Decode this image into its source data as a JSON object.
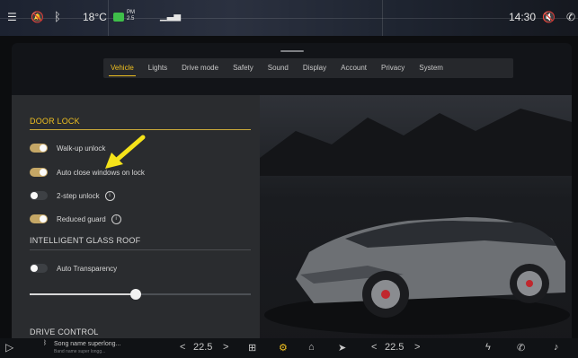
{
  "status_bar": {
    "temperature": "18°C",
    "pm_label": "PM",
    "pm_value": "2.5",
    "time": "14:30",
    "icons": [
      "menu-lines-icon",
      "notifications-muted-icon",
      "bluetooth-icon",
      "air-quality-leaf-icon",
      "signal-icon",
      "mute-icon",
      "phone-icon"
    ]
  },
  "tabs": [
    "Vehicle",
    "Lights",
    "Drive mode",
    "Safety",
    "Sound",
    "Display",
    "Account",
    "Privacy",
    "System"
  ],
  "active_tab": "Vehicle",
  "door_lock": {
    "title": "DOOR LOCK",
    "items": [
      {
        "label": "Walk-up unlock",
        "on": true,
        "info": false
      },
      {
        "label": "Auto close windows on lock",
        "on": true,
        "info": false
      },
      {
        "label": "2-step unlock",
        "on": false,
        "info": true
      },
      {
        "label": "Reduced guard",
        "on": true,
        "info": true
      }
    ]
  },
  "glass_roof": {
    "title": "INTELLIGENT GLASS ROOF",
    "transparency_label": "Auto Transparency",
    "transparency_on": false,
    "slider_level": 0.48
  },
  "drive_control": {
    "title": "DRIVE CONTROL"
  },
  "bottom_bar": {
    "song": "Song name superlong...",
    "song_sub": "Band name super longg...",
    "left_temp": "22.5",
    "right_temp": "22.5",
    "left_chevron": "<",
    "right_chevron": ">",
    "icons": [
      "play-icon",
      "bluetooth-small-icon",
      "apps-grid-icon",
      "settings-gear-icon",
      "car-icon",
      "navigation-icon",
      "fan-icon",
      "phone-icon",
      "music-icon"
    ]
  },
  "colors": {
    "accent": "#f0c020",
    "toggle_on": "#c5a766",
    "annotation_arrow": "#f5e31a"
  }
}
